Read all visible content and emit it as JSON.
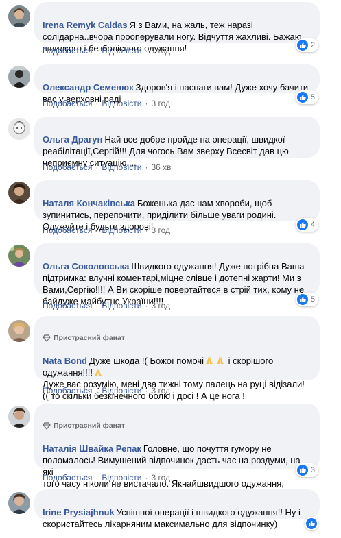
{
  "actions": {
    "like": "Подобається",
    "reply": "Відповісти",
    "sep": "·"
  },
  "fan_badge": "Пристрасний фанат",
  "comments": [
    {
      "author": "Irena Remyk Caldas",
      "text": "Я з Вами, на жаль, теж наразі\nсолідарна..вчора прооперували ногу. Відчуття жахливі. Бажаю\nшвидкого і безболісного одужання!",
      "time": "1 год",
      "likes": "2"
    },
    {
      "author": "Олександр Семенюк",
      "text": "Здоров'я і наснаги вам! Дуже хочу бачити\nвас у верховні раді",
      "time": "3 год",
      "likes": "5"
    },
    {
      "author": "Ольга Драгун",
      "text": "Най все добре пройде на операції, швидкої\nреабілітації,Сергій!!! Для чогось Вам зверху Всесвіт дав цю\nнеприємну ситуацію....",
      "time": "36 хв",
      "likes": ""
    },
    {
      "author": "Наталя Кончаківська",
      "text": "Боженька дає нам хвороби, щоб\nзупинитись, перепочити, приділити більше уваги родині.\nОдужуйте і будьте здорові!",
      "time": "3 год",
      "likes": "4"
    },
    {
      "author": "Ольга Соколовська",
      "text": "Швидкого одужання! Дуже потрібна Ваша\nпідтримка: влучні коментарі,міцне слівце і дотепні жарти! Ми з\nВами,Сергію!!!! А Ви скоріше повертайтеся в стрій тих, кому не\nбайдуже майбутнє України!!!!",
      "time": "3 год",
      "likes": "5"
    },
    {
      "author": "Nata Bond",
      "fan": true,
      "text_a": "Дуже шкода !( Божої помочі",
      "text_b": " і скорішого\nодужання!!!!",
      "text_c": "\nДуже вас розумію, мені два тижні тому палець на руці відізали!\n(( то скільки безкінечного болю і досі ! А це нога !",
      "time": "3 год",
      "likes": ""
    },
    {
      "author": "Наталія Швайка Репак",
      "fan": true,
      "text": "Головне, що почуття гумору не\nполомалось! Вимушений відпочинок дасть час на роздуми, на які\nтого часу ніколи не вистачало. Якнайшвидшого одужання,\nзвичайно!",
      "time": "3 год",
      "likes": "3"
    },
    {
      "author": "Irine Prysiajhnuk",
      "text": "Успішної операції і швидкого одужання!! Ну і\nскористайтесь лікарняним максимально для відпочинку)",
      "time": "",
      "likes": ""
    }
  ]
}
